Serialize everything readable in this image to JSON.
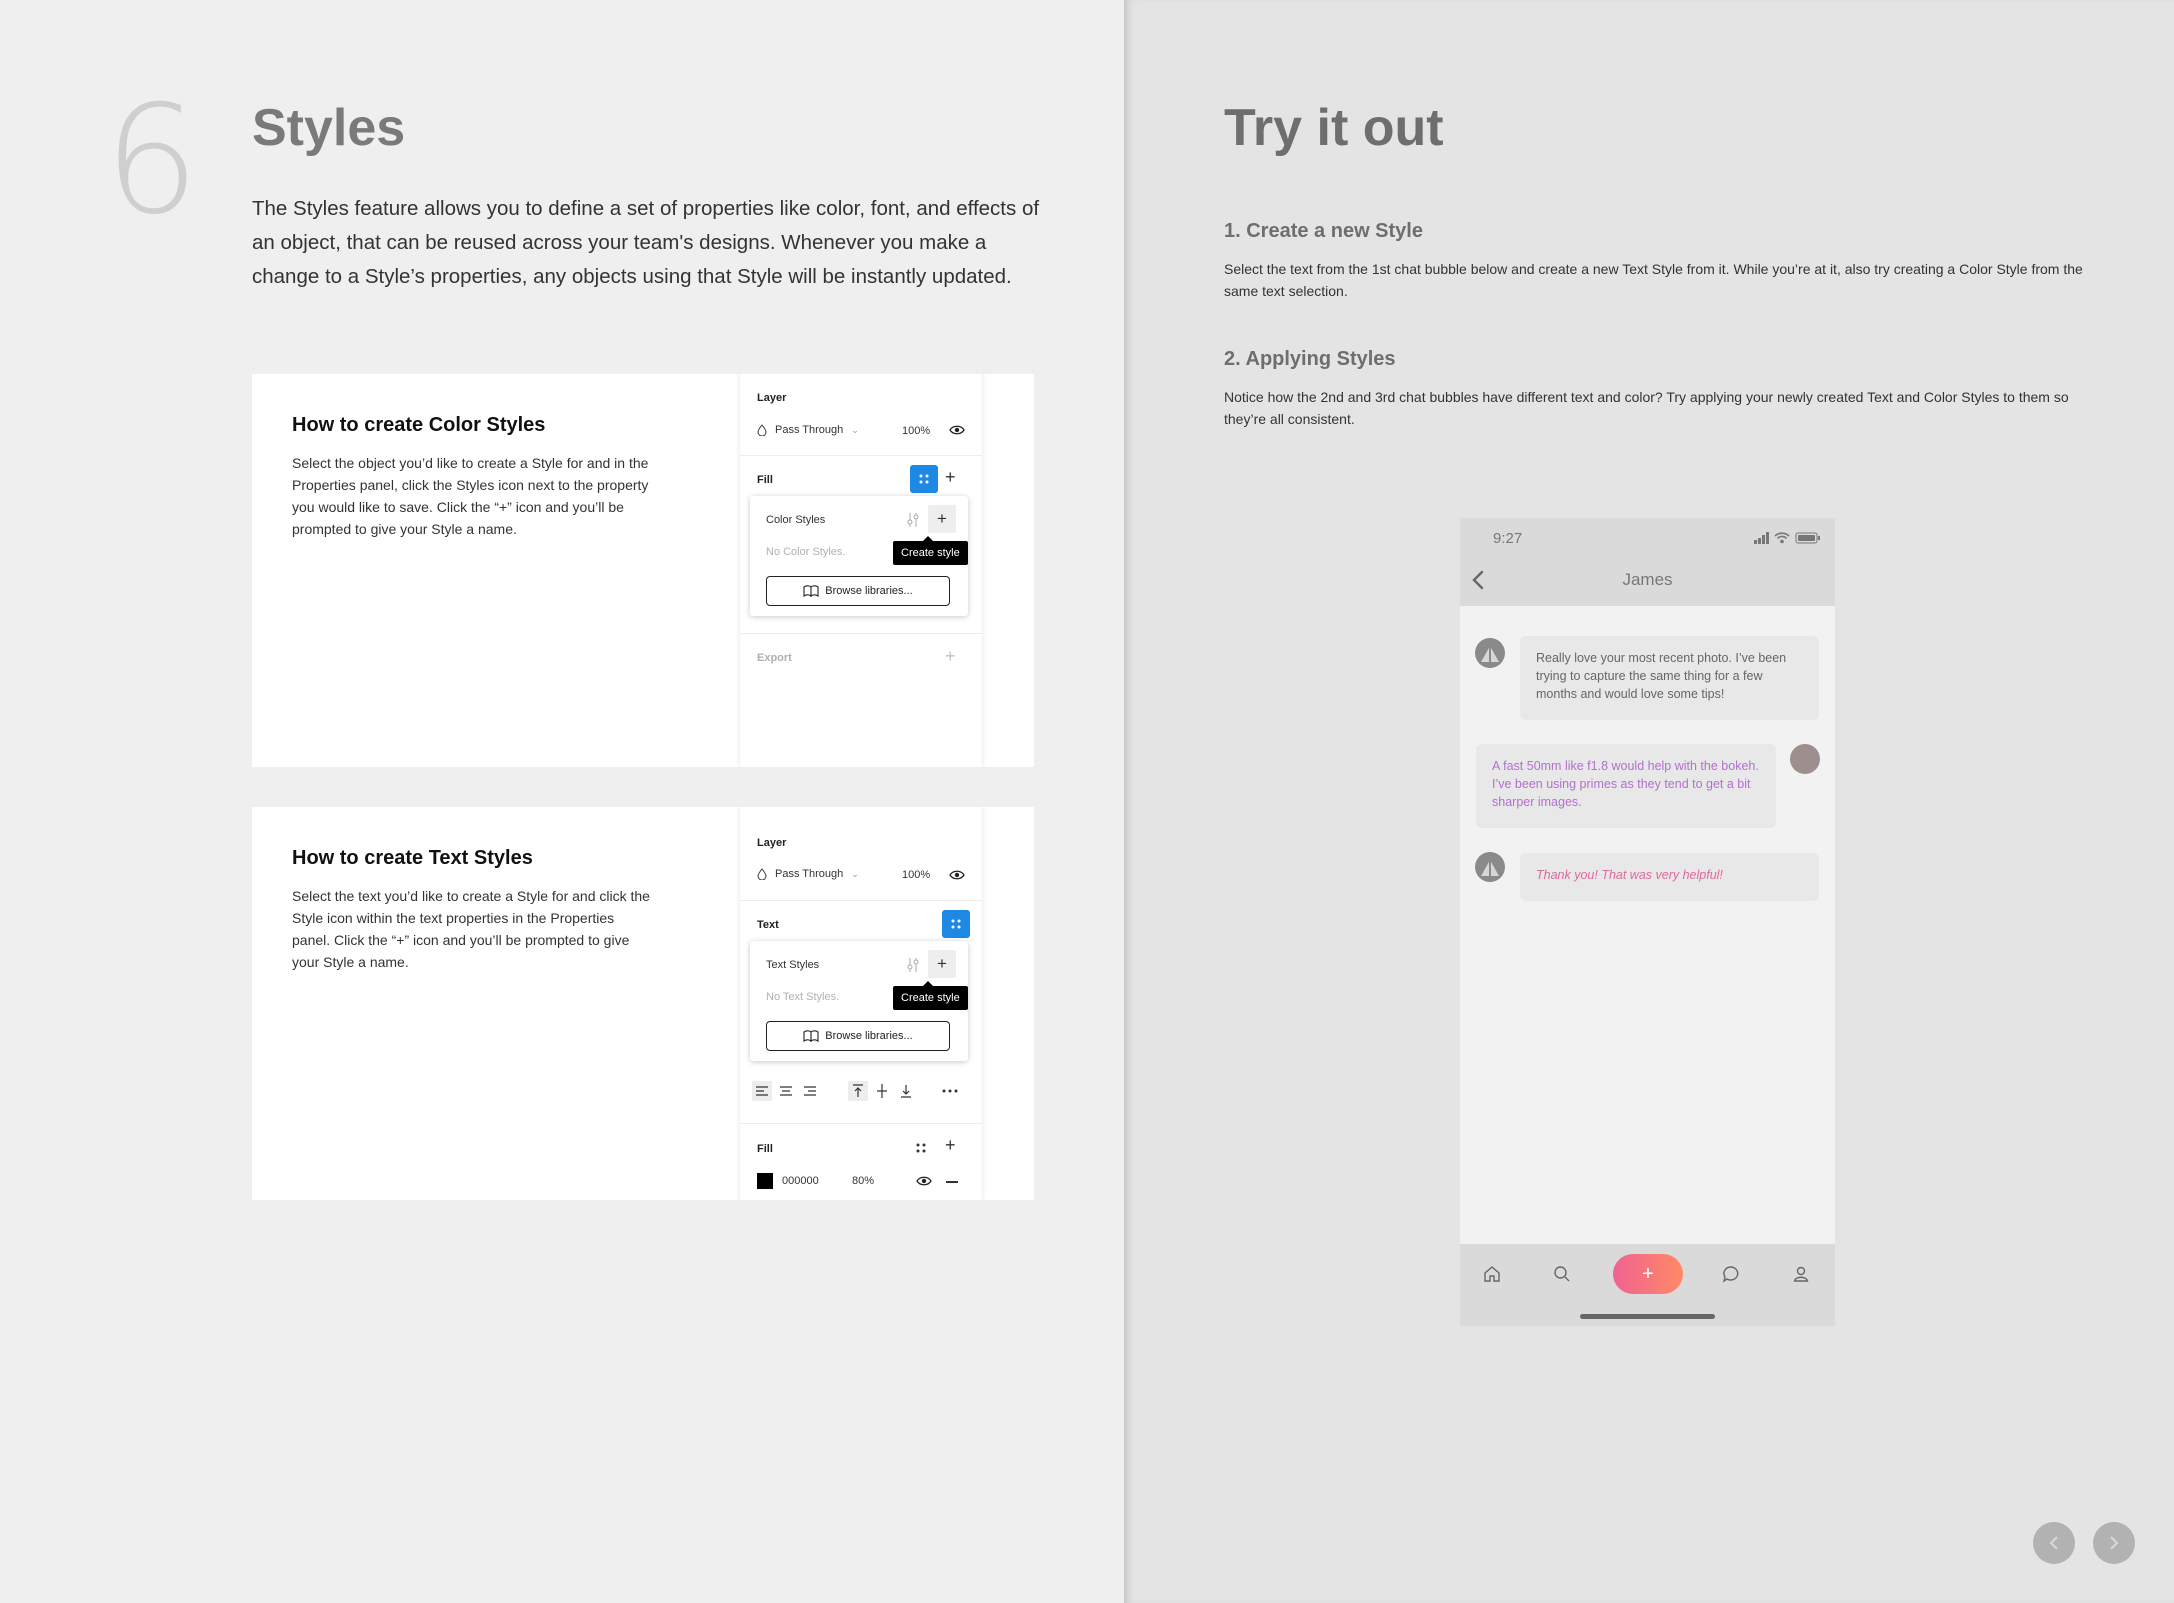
{
  "left": {
    "step_number": "6",
    "title": "Styles",
    "intro": "The Styles feature allows you to define a set of properties like color, font, and effects of an object, that can be reused across your team's designs. Whenever you make a change to a Style’s properties, any objects using that Style will be instantly updated.",
    "color_card": {
      "heading": "How to create Color Styles",
      "body": "Select the object you’d like to create a Style for and in the Properties panel, click the Styles icon next to the property you would like to save. Click the “+” icon and you’ll be prompted to give your Style a name.",
      "panel": {
        "layer_label": "Layer",
        "blend_mode": "Pass Through",
        "opacity": "100%",
        "fill_label": "Fill",
        "popup_title": "Color Styles",
        "empty_text": "No Color Styles.",
        "tooltip": "Create style",
        "browse_label": "Browse libraries...",
        "export_label": "Export"
      }
    },
    "text_card": {
      "heading": "How to create Text Styles",
      "body": "Select the text you’d like to create a Style for and click the Style icon within the text properties in the Properties panel. Click the “+” icon and you’ll be prompted to give your Style a name.",
      "panel": {
        "layer_label": "Layer",
        "blend_mode": "Pass Through",
        "opacity": "100%",
        "text_label": "Text",
        "popup_title": "Text Styles",
        "empty_text": "No Text Styles.",
        "tooltip": "Create style",
        "browse_label": "Browse libraries...",
        "fill_label": "Fill",
        "fill_hex": "000000",
        "fill_opacity": "80%"
      }
    }
  },
  "right": {
    "title": "Try it out",
    "step1_heading": "1. Create a new Style",
    "step1_body": "Select the text from the 1st chat bubble below and create a new Text Style from it. While you’re at it, also try creating a Color Style from the same text selection.",
    "step2_heading": "2. Applying Styles",
    "step2_body": "Notice how the 2nd and 3rd chat bubbles have different text and color? Try applying your newly created Text and Color Styles to them so they’re all consistent.",
    "phone": {
      "time": "9:27",
      "contact_name": "James",
      "messages": [
        {
          "text": "Really love your most recent photo. I’ve been trying to capture the same thing for a few months and would love some tips!",
          "color": "#666666"
        },
        {
          "text": "A fast 50mm like f1.8 would help with the bokeh. I’ve been using primes as they tend to get a bit sharper images.",
          "color": "#b36fd1"
        },
        {
          "text": "Thank you! That was very helpful!",
          "color": "#e0699a"
        }
      ],
      "tab_icons": [
        "home-icon",
        "search-icon",
        "plus-icon",
        "chat-icon",
        "profile-icon"
      ],
      "accent_gradient": [
        "#f06292",
        "#ff8a65"
      ]
    },
    "nav": {
      "prev_icon": "chevron-left-icon",
      "next_icon": "chevron-right-icon"
    }
  }
}
